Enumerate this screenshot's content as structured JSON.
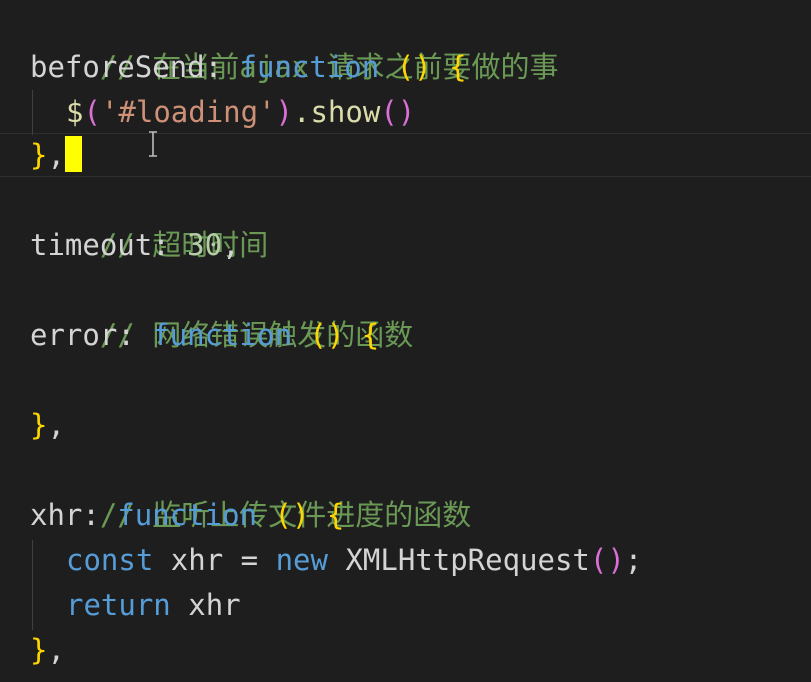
{
  "editor": {
    "lines": [
      {
        "comment": "// 在当前ajax 请求之前要做的事"
      },
      {
        "key": "beforeSend",
        "colon": ":",
        "kw": "function",
        "paren": "()",
        "brace": "{"
      },
      {
        "dollar": "$",
        "open": "(",
        "str": "'#loading'",
        "close": ")",
        "method": ".show",
        "call": "()"
      },
      {
        "brace": "}",
        "comma": ","
      },
      {
        "comment": "// 超时时间"
      },
      {
        "key": "timeout",
        "colon": ":",
        "num": "30",
        "comma": ","
      },
      {
        "comment": "// 网络错误触发的函数"
      },
      {
        "key": "error",
        "colon": ":",
        "kw": "function",
        "paren": "()",
        "brace": "{"
      },
      {
        "brace": "}",
        "comma": ","
      },
      {
        "comment": "// 监听上传文件进度的函数"
      },
      {
        "key": "xhr",
        "colon": ":",
        "kw": "function",
        "paren": "()",
        "brace": "{"
      },
      {
        "kw": "const",
        "var": "xhr",
        "eq": "=",
        "new": "new",
        "cls": "XMLHttpRequest",
        "call": "()",
        "semi": ";"
      },
      {
        "kw": "return",
        "var": "xhr"
      },
      {
        "brace": "}",
        "comma": ","
      }
    ]
  },
  "theme": {
    "background": "#1e1e1e",
    "comment": "#6a9955",
    "keyword": "#569cd6",
    "string": "#ce9178",
    "number": "#b5cea8",
    "bracket": "#ffd700",
    "bracket_nested": "#da70d6",
    "cursor": "#ffff00"
  }
}
